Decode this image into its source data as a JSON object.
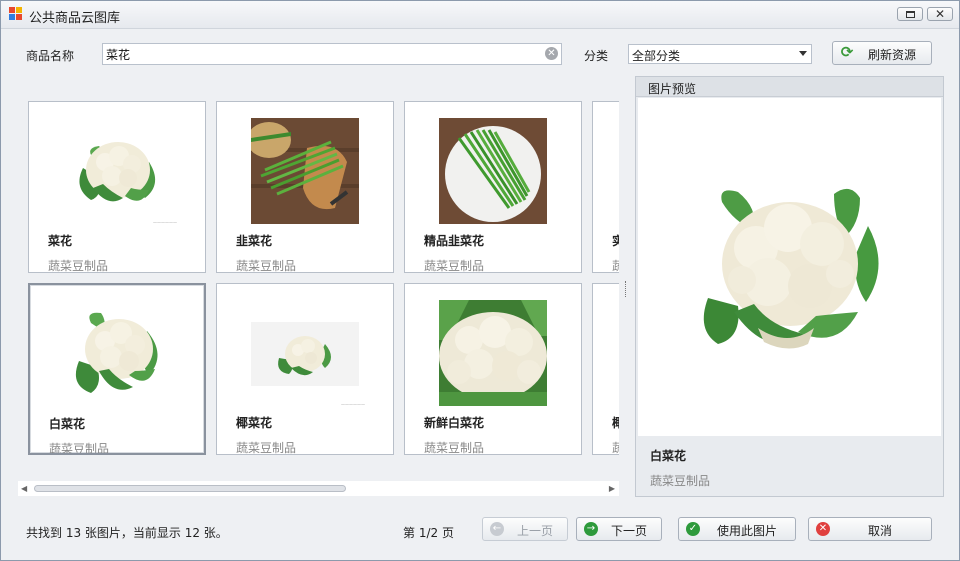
{
  "window": {
    "title": "公共商品云图库"
  },
  "filters": {
    "name_label": "商品名称",
    "name_value": "菜花",
    "category_label": "分类",
    "category_value": "全部分类",
    "refresh_label": "刷新资源"
  },
  "cards": [
    {
      "name": "菜花",
      "category": "蔬菜豆制品",
      "image": "cauliflower"
    },
    {
      "name": "韭菜花",
      "category": "蔬菜豆制品",
      "image": "chive-board"
    },
    {
      "name": "精品韭菜花",
      "category": "蔬菜豆制品",
      "image": "chive-plate"
    },
    {
      "name": "实",
      "category": "蔬",
      "image": "partial"
    },
    {
      "name": "白菜花",
      "category": "蔬菜豆制品",
      "image": "cauliflower"
    },
    {
      "name": "椰菜花",
      "category": "蔬菜豆制品",
      "image": "cauliflower-small"
    },
    {
      "name": "新鲜白菜花",
      "category": "蔬菜豆制品",
      "image": "cauliflower-closeup"
    },
    {
      "name": "椰",
      "category": "蔬",
      "image": "partial"
    }
  ],
  "preview": {
    "header": "图片预览",
    "name": "白菜花",
    "category": "蔬菜豆制品"
  },
  "footer": {
    "status": "共找到 13 张图片，当前显示 12 张。",
    "page_info": "第 1/2 页",
    "prev_label": "上一页",
    "next_label": "下一页",
    "use_label": "使用此图片",
    "cancel_label": "取消"
  },
  "colors": {
    "refresh_icon": "#3a9a3a",
    "next_icon": "#2e9a3c",
    "use_icon": "#2e9a3c",
    "cancel_icon": "#e0403f"
  }
}
